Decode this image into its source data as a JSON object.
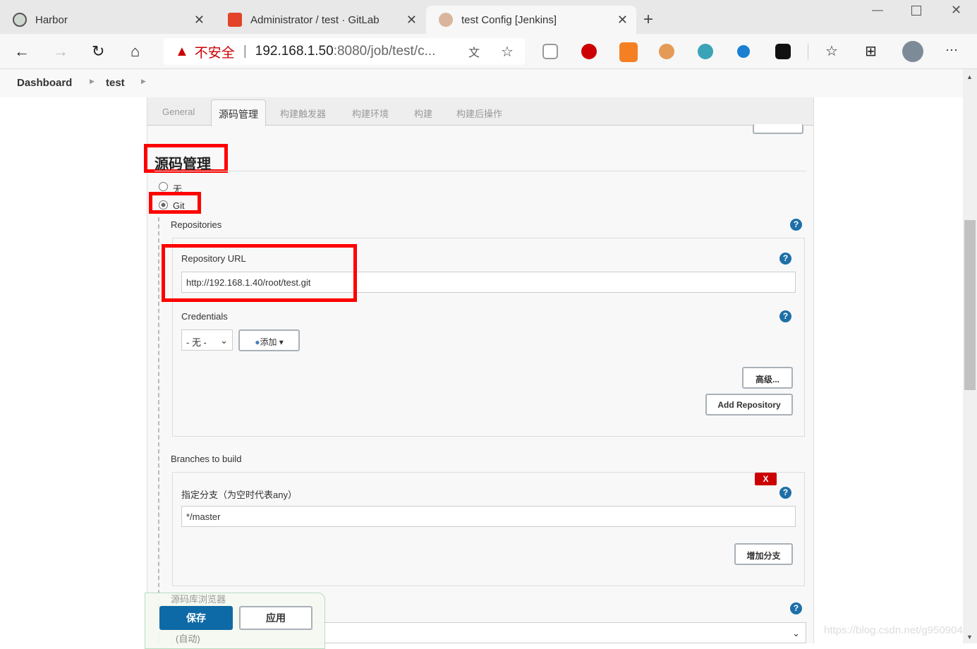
{
  "browser": {
    "tabs": [
      {
        "title": "Harbor"
      },
      {
        "title": "Administrator / test · GitLab"
      },
      {
        "title": "test Config [Jenkins]"
      }
    ],
    "address": {
      "warning": "不安全",
      "host": "192.168.1.50",
      "rest": ":8080/job/test/c..."
    },
    "extensions": [
      "mcafee-icon",
      "adblock-plus-icon",
      "off-icon",
      "document-icon",
      "fruit-icon",
      "cloud-icon",
      "tampermonkey-icon"
    ],
    "more": "···"
  },
  "breadcrumb": [
    "Dashboard",
    "test"
  ],
  "config_tabs": [
    "General",
    "源码管理",
    "构建触发器",
    "构建环境",
    "构建",
    "构建后操作"
  ],
  "section": {
    "title": "源码管理",
    "scm_options": [
      {
        "label": "无",
        "selected": false
      },
      {
        "label": "Git",
        "selected": true
      }
    ]
  },
  "repositories": {
    "label": "Repositories",
    "url_label": "Repository URL",
    "url_value": "http://192.168.1.40/root/test.git",
    "credentials_label": "Credentials",
    "credentials_value": "- 无 -",
    "add_label": "添加",
    "advanced_label": "高级...",
    "add_repo_label": "Add Repository"
  },
  "branches": {
    "label": "Branches to build",
    "spec_label": "指定分支（为空时代表any）",
    "spec_value": "*/master",
    "delete_label": "X",
    "add_branch_label": "增加分支"
  },
  "footer": {
    "save": "保存",
    "apply": "应用",
    "hidden_label": "源码库浏览器",
    "hidden_value": "(自动)"
  },
  "watermark": "https://blog.csdn.net/g950904",
  "colors": {
    "accent": "#1e6fa8",
    "highlight": "#ff0000",
    "save": "#0e6aa6"
  }
}
